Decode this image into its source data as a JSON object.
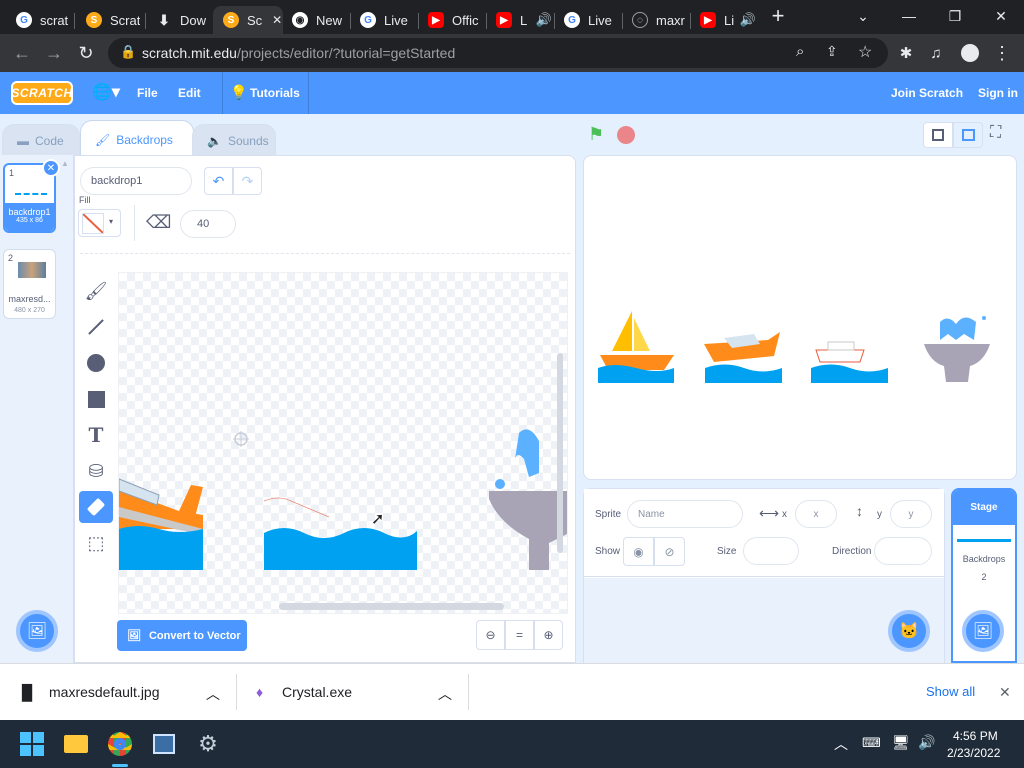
{
  "browser": {
    "tabs": [
      {
        "title": "scrat",
        "icon": "google-icon",
        "color": "#ffffff"
      },
      {
        "title": "Scrat",
        "icon": "scratch-icon",
        "color": "#ffab19"
      },
      {
        "title": "Dow",
        "icon": "download-icon",
        "color": "#ffffff"
      },
      {
        "title": "Sc",
        "icon": "scratch-icon",
        "color": "#ffab19"
      },
      {
        "title": "New",
        "icon": "chrome-icon",
        "color": "#ffffff"
      },
      {
        "title": "Live",
        "icon": "google-icon",
        "color": "#ffffff"
      },
      {
        "title": "Offic",
        "icon": "youtube-icon",
        "color": "#ff0000"
      },
      {
        "title": "Li",
        "icon": "youtube-icon",
        "color": "#ff0000"
      },
      {
        "title": "Live",
        "icon": "google-icon",
        "color": "#ffffff"
      },
      {
        "title": "maxr",
        "icon": "globe-icon",
        "color": "#ffffff"
      },
      {
        "title": "Li",
        "icon": "youtube-icon",
        "color": "#ff0000"
      }
    ],
    "new_tab": "+",
    "url_host": "scratch.mit.edu",
    "url_path": "/projects/editor/?tutorial=getStarted"
  },
  "menu": {
    "logo": "SCRATCH",
    "file": "File",
    "edit": "Edit",
    "tutorials": "Tutorials",
    "join": "Join Scratch",
    "signin": "Sign in"
  },
  "tabs": {
    "code": "Code",
    "backdrops": "Backdrops",
    "sounds": "Sounds"
  },
  "costumes": [
    {
      "num": "1",
      "name": "backdrop1",
      "size": "435 x 86"
    },
    {
      "num": "2",
      "name": "maxresd...",
      "size": "480 x 270"
    }
  ],
  "paint": {
    "costume_name": "backdrop1",
    "fill_label": "Fill",
    "eraser_size": "40",
    "convert_button": "Convert to Vector",
    "zoom_reset": "="
  },
  "sprite_info": {
    "sprite_label": "Sprite",
    "name_placeholder": "Name",
    "x_label": "x",
    "x_placeholder": "x",
    "y_label": "y",
    "y_placeholder": "y",
    "show_label": "Show",
    "size_label": "Size",
    "direction_label": "Direction"
  },
  "stage_pane": {
    "title": "Stage",
    "backdrops_label": "Backdrops",
    "backdrops_count": "2"
  },
  "downloads": {
    "item1": "maxresdefault.jpg",
    "item2": "Crystal.exe",
    "show_all": "Show all"
  },
  "taskbar": {
    "time": "4:56 PM",
    "date": "2/23/2022"
  },
  "colors": {
    "scratch_blue": "#4c97ff",
    "water": "#00a1f1",
    "boat_orange": "#ff8c1a"
  }
}
